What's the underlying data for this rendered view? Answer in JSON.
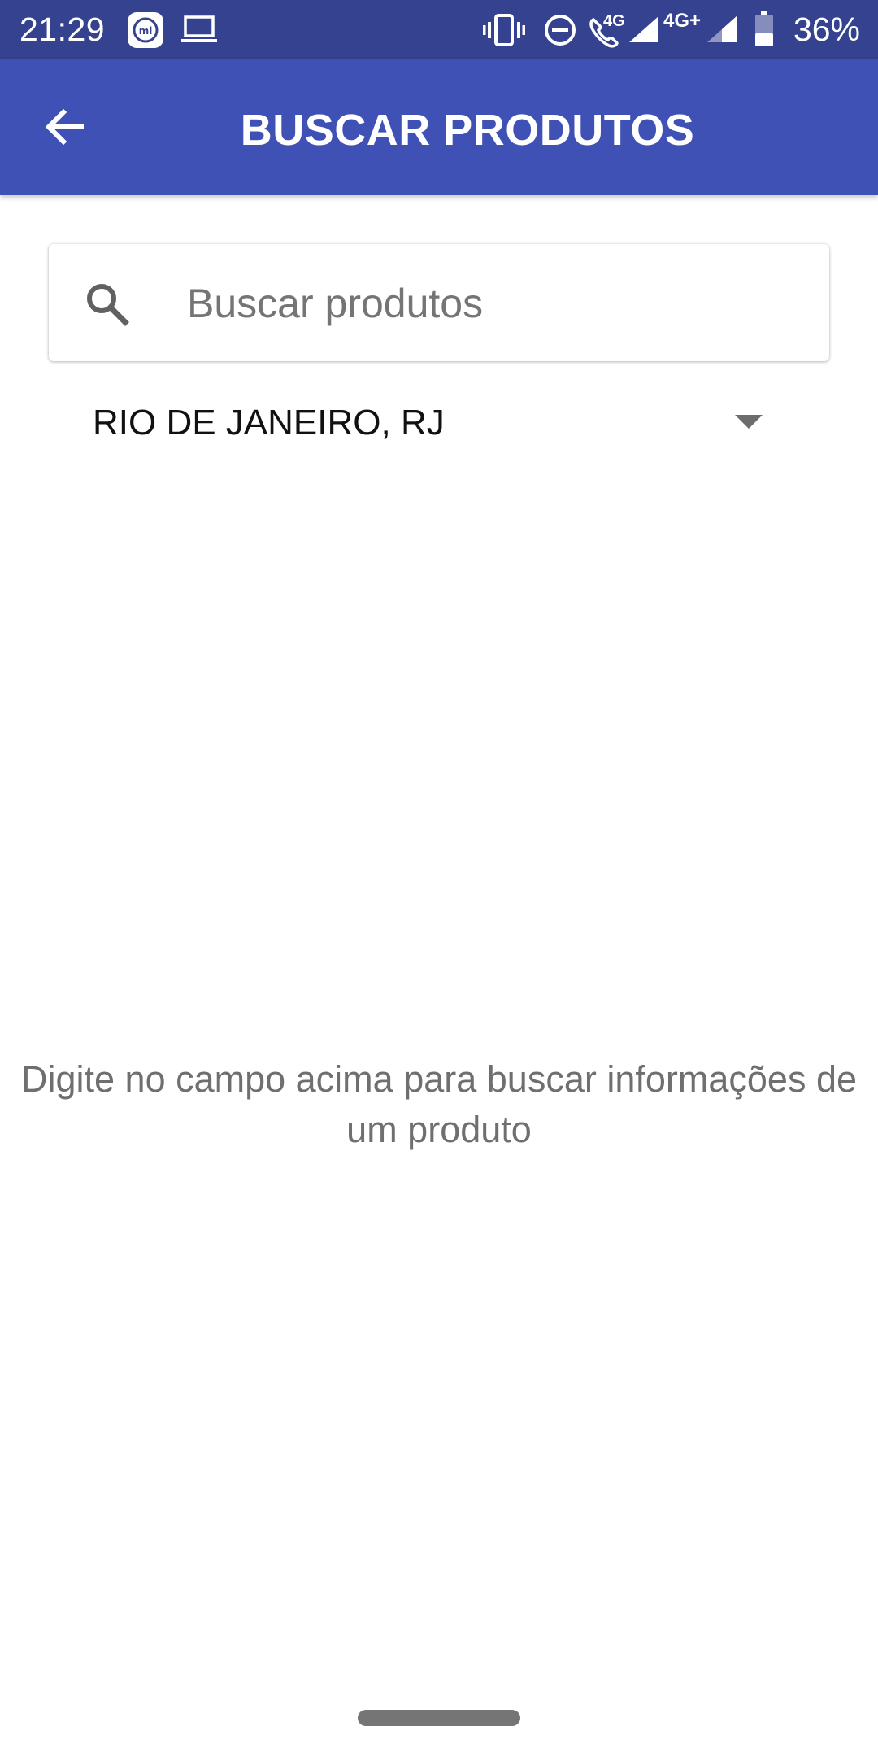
{
  "status_bar": {
    "time": "21:29",
    "battery_percent": "36%",
    "call_network_label": "4G",
    "data_network_label": "4G+",
    "icons": [
      "mi-icon",
      "laptop-icon",
      "vibrate-icon",
      "dnd-icon",
      "call-4g-icon",
      "signal-icon",
      "signal-icon",
      "battery-icon"
    ]
  },
  "app_bar": {
    "title": "BUSCAR PRODUTOS",
    "back_icon": "arrow-back-icon",
    "background": "#3f51b5"
  },
  "search": {
    "placeholder": "Buscar produtos",
    "value": ""
  },
  "location": {
    "selected": "RIO DE JANEIRO, RJ"
  },
  "empty_state": {
    "message": "Digite no campo acima para buscar informações de um produto"
  }
}
